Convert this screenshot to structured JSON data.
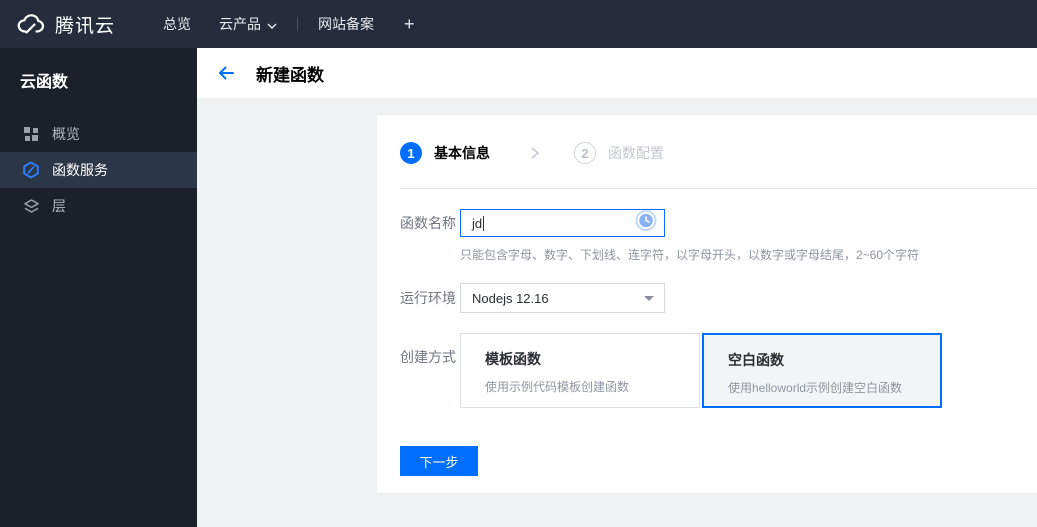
{
  "topbar": {
    "brand": "腾讯云",
    "nav": [
      {
        "label": "总览",
        "has_caret": false
      },
      {
        "label": "云产品",
        "has_caret": true
      },
      {
        "label": "网站备案",
        "has_caret": false
      }
    ],
    "plus_label": "+"
  },
  "sidebar": {
    "title": "云函数",
    "items": [
      {
        "label": "概览",
        "icon": "grid-icon",
        "selected": false
      },
      {
        "label": "函数服务",
        "icon": "scf-hexagon-icon",
        "selected": true
      },
      {
        "label": "层",
        "icon": "layers-icon",
        "selected": false
      }
    ]
  },
  "header": {
    "title": "新建函数",
    "back_icon": "arrow-left-icon"
  },
  "wizard": {
    "steps": [
      {
        "number": "1",
        "label": "基本信息",
        "state": "active"
      },
      {
        "number": "2",
        "label": "函数配置",
        "state": "inactive"
      }
    ]
  },
  "form": {
    "name": {
      "label": "函数名称",
      "value": "jd",
      "status_icon": "clock-icon",
      "helper": "只能包含字母、数字、下划线、连字符，以字母开头，以数字或字母结尾，2~60个字符"
    },
    "runtime": {
      "label": "运行环境",
      "value": "Nodejs 12.16"
    },
    "creation": {
      "label": "创建方式",
      "options": [
        {
          "title": "模板函数",
          "desc": "使用示例代码模板创建函数",
          "selected": false
        },
        {
          "title": "空白函数",
          "desc": "使用helloworld示例创建空白函数",
          "selected": true
        }
      ]
    }
  },
  "actions": {
    "next_label": "下一步"
  },
  "colors": {
    "accent": "#006eff",
    "topbar_bg": "#252d3c",
    "sidebar_bg": "#1b202b",
    "sidebar_selected_bg": "#2b3646",
    "content_bg": "#f0f1f2",
    "status_icon_blue": "#8ab4f0"
  }
}
